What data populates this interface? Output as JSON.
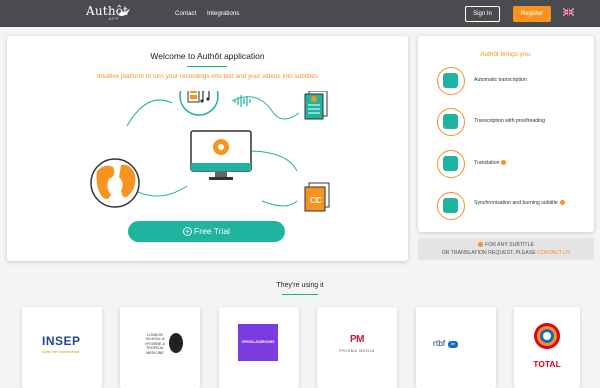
{
  "header": {
    "brand": "Authôt",
    "brand_sub": "APP",
    "nav": [
      "Contact",
      "Integrations"
    ],
    "signin_label": "Sign In",
    "register_label": "Register",
    "language_icon": "uk-flag-icon"
  },
  "main": {
    "title": "Welcome to Authôt application",
    "tagline": "Intuitive platform to turn your recordings into text and your videos into subtitles",
    "cc_label": "CC",
    "cta_label": "Free Trial",
    "cta_icon": "plus-circle-icon"
  },
  "side": {
    "title": "Authôt brings you:",
    "features": [
      {
        "label": "Automatic transcription",
        "icon": "gear-icon",
        "badge": false
      },
      {
        "label": "Transcription with proofreading",
        "icon": "document-icon",
        "badge": false
      },
      {
        "label": "Translation",
        "icon": "chat-bubbles-icon",
        "badge": true
      },
      {
        "label": "Synchronisation and burning subtitle",
        "icon": "sync-icon",
        "badge": true
      }
    ],
    "notice_line1": "FOR ANY SUBTITLE",
    "notice_line2_prefix": "OR TRANSLATION REQUEST, PLEASE ",
    "notice_contact": "CONTACT US"
  },
  "using": {
    "title": "They're using it",
    "clients": [
      {
        "name": "INSEP",
        "tagline": "Sport de haut niveau"
      },
      {
        "name": "LONDON SCHOOL of HYGIENE & TROPICAL MEDICINE"
      },
      {
        "name": "OPENCLASSROOMS"
      },
      {
        "name": "PM",
        "tagline": "PRISMA MEDIA"
      },
      {
        "name": "rtbf",
        "badge": ".be"
      },
      {
        "name": "TOTAL"
      }
    ]
  },
  "colors": {
    "topbar": "#4a4b4f",
    "accent_orange": "#f7931e",
    "accent_teal": "#1eb49f"
  }
}
